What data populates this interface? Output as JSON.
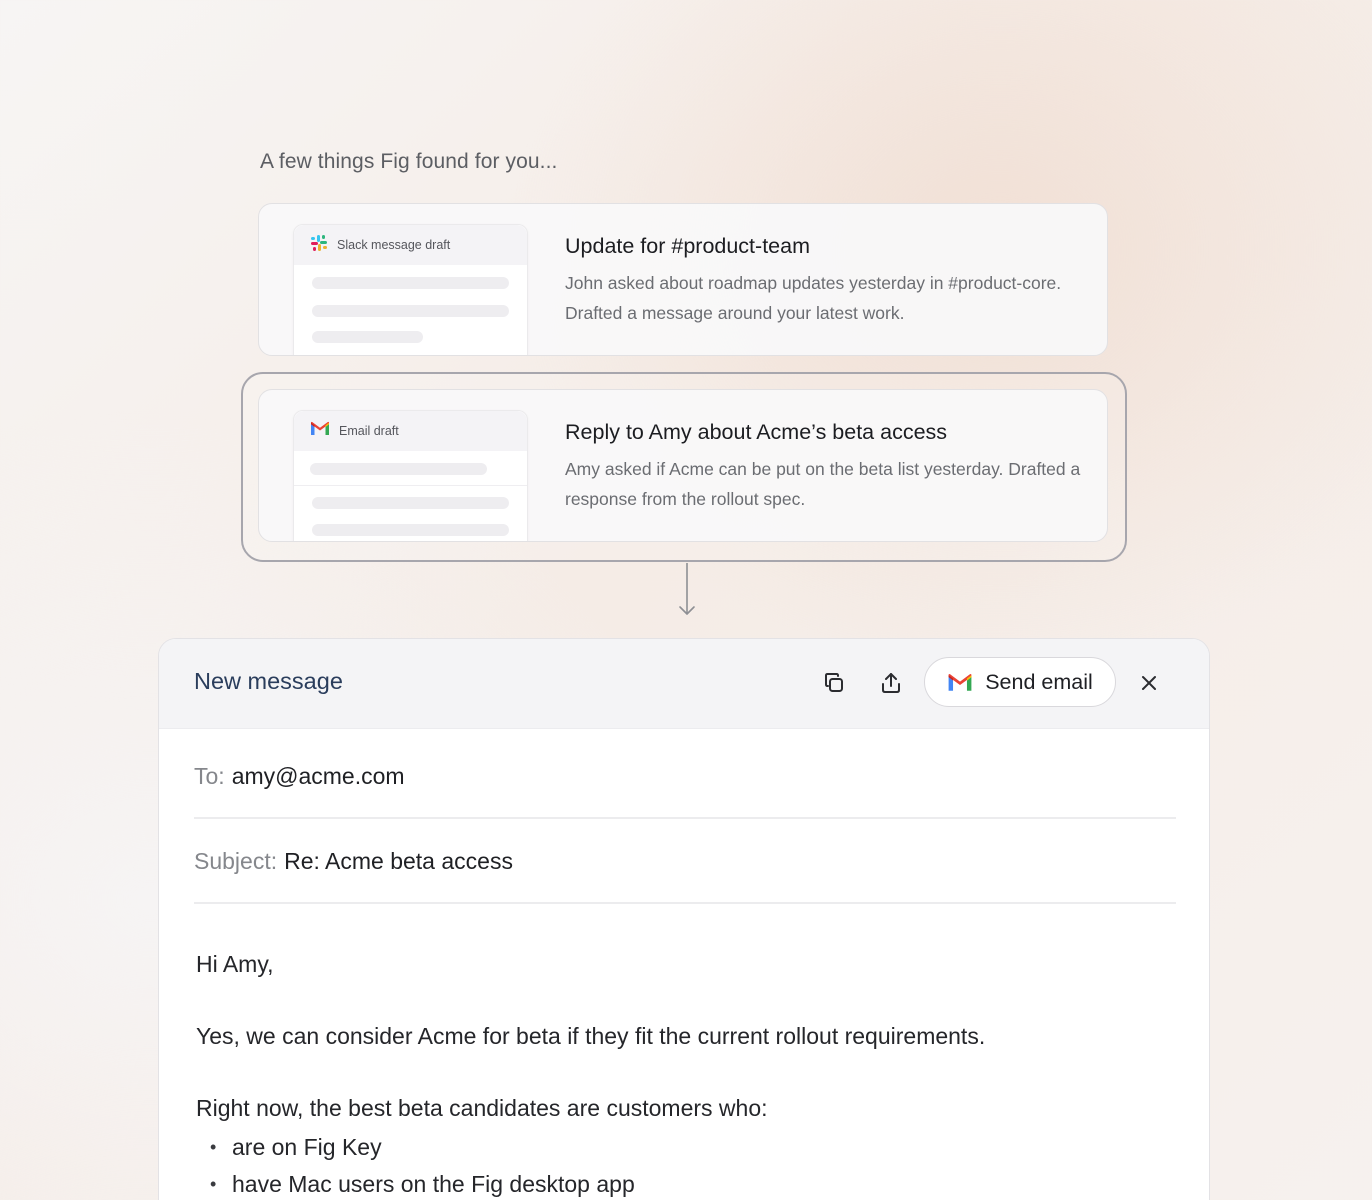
{
  "intro": "A few things Fig found for you...",
  "suggestions": [
    {
      "preview_label": "Slack message draft",
      "preview_icon": "slack-icon",
      "title": "Update for #product-team",
      "description": "John asked about roadmap updates yesterday in #product-core. Drafted a message around your latest work."
    },
    {
      "preview_label": "Email draft",
      "preview_icon": "gmail-icon",
      "title": "Reply to Amy about Acme’s beta access",
      "description": "Amy asked if Acme can be put on the beta list yesterday. Drafted a response from the rollout spec."
    }
  ],
  "compose": {
    "title": "New message",
    "send_label": "Send email",
    "icons": [
      "copy-icon",
      "share-icon",
      "gmail-icon",
      "close-icon"
    ],
    "to_label": "To:",
    "to_value": "amy@acme.com",
    "subject_label": "Subject:",
    "subject_value": "Re: Acme beta access",
    "greeting": "Hi Amy,",
    "paragraph1": "Yes, we can consider Acme for beta if they fit the current rollout requirements.",
    "paragraph2": "Right now, the best beta candidates are customers who:",
    "bullets": [
      "are on Fig Key",
      "have Mac users on the Fig desktop app"
    ]
  },
  "colors": {
    "gmail_red": "#EA4335",
    "gmail_blue": "#4285F4",
    "gmail_green": "#34A853",
    "gmail_yellow": "#FBBC04",
    "slack_purple": "#4A154B",
    "slack_blue": "#36C5F0",
    "slack_green": "#2EB67D",
    "slack_red": "#E01E5A",
    "slack_yellow": "#ECB22E",
    "compose_title": "#2a3d5c"
  }
}
